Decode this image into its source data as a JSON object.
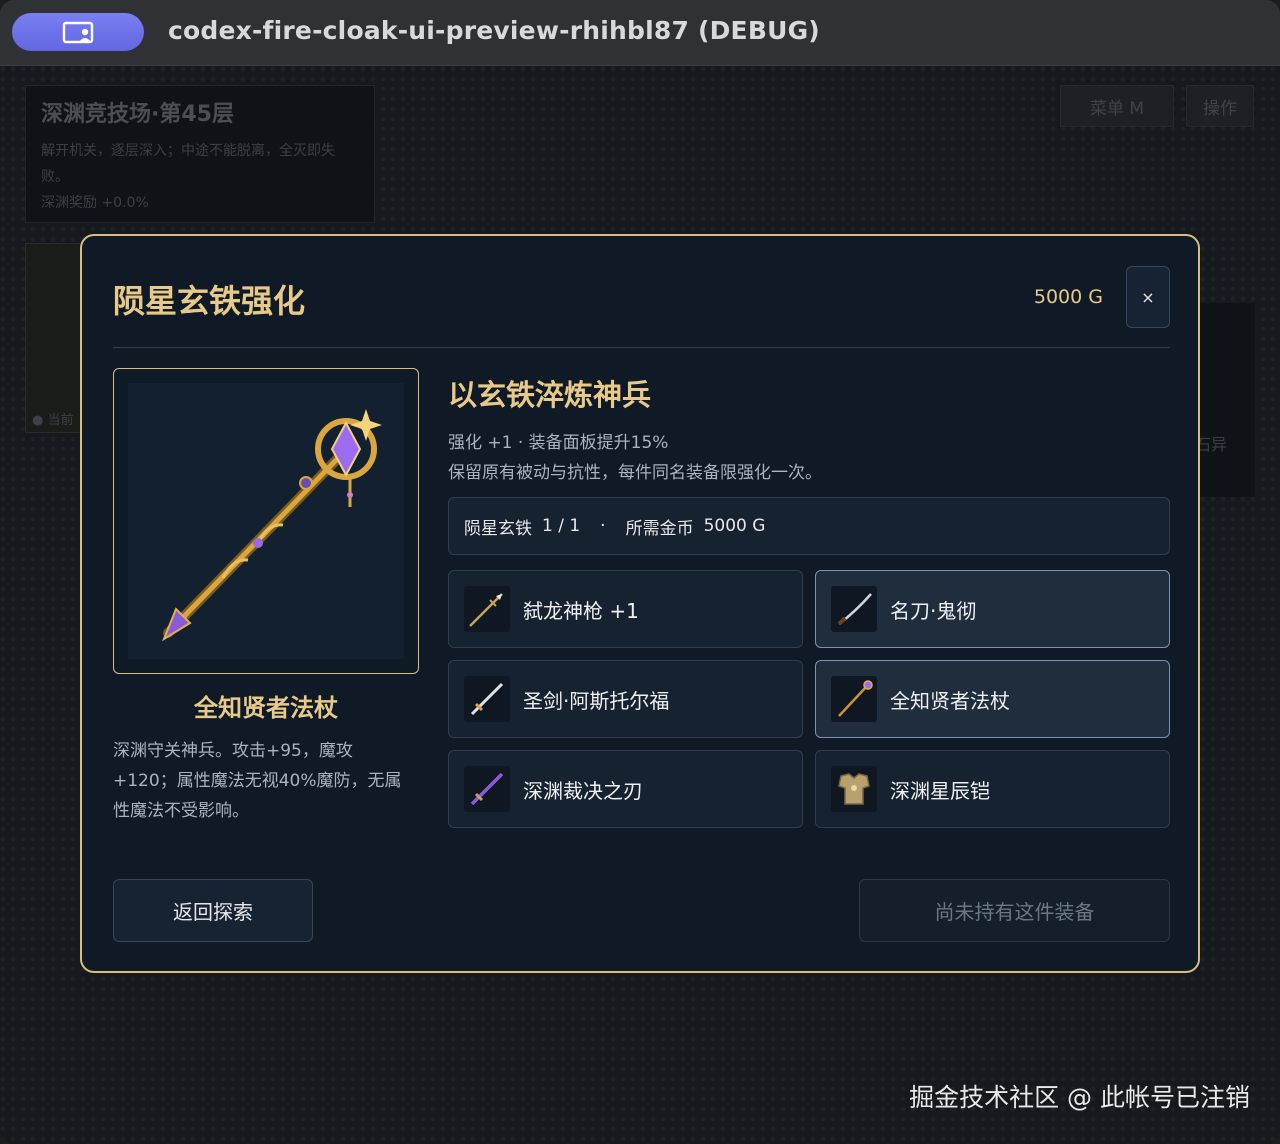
{
  "window": {
    "title": "codex-fire-cloak-ui-preview-rhihbl87 (DEBUG)"
  },
  "background": {
    "arena_title": "深渊竞技场·第45层",
    "arena_desc": "解开机关，逐层深入；中途不能脱离，全灭即失败。",
    "arena_reward": "深渊奖励 +0.0%",
    "menu_button": "菜单  M",
    "action_button": "操作",
    "left_card_label": "● 当前",
    "right_card_label": "石异"
  },
  "modal": {
    "title": "陨星玄铁强化",
    "gold": "5000 G",
    "close_label": "×",
    "selected_item": {
      "name": "全知贤者法杖",
      "description": "深渊守关神兵。攻击+95，魔攻+120；属性魔法无视40%魔防，无属性魔法不受影响。"
    },
    "heading": "以玄铁淬炼神兵",
    "info_line_1": "强化 +1 · 装备面板提升15%",
    "info_line_2": "保留原有被动与抗性，每件同名装备限强化一次。",
    "requirement": {
      "material": "陨星玄铁",
      "count": "1 / 1",
      "separator": "·",
      "gold_label": "所需金币",
      "gold_value": "5000 G"
    },
    "equipment": [
      {
        "label": "弑龙神枪 +1",
        "icon": "spear-icon",
        "selected": false
      },
      {
        "label": "名刀·鬼彻",
        "icon": "katana-icon",
        "selected": true
      },
      {
        "label": "圣剑·阿斯托尔福",
        "icon": "holy-sword-icon",
        "selected": false
      },
      {
        "label": "全知贤者法杖",
        "icon": "staff-icon",
        "selected": true
      },
      {
        "label": "深渊裁决之刃",
        "icon": "abyss-blade-icon",
        "selected": false
      },
      {
        "label": "深渊星辰铠",
        "icon": "armor-icon",
        "selected": false
      }
    ],
    "back_button": "返回探索",
    "action_button_disabled": "尚未持有这件装备"
  },
  "watermark": "掘金技术社区 @ 此帐号已注销"
}
